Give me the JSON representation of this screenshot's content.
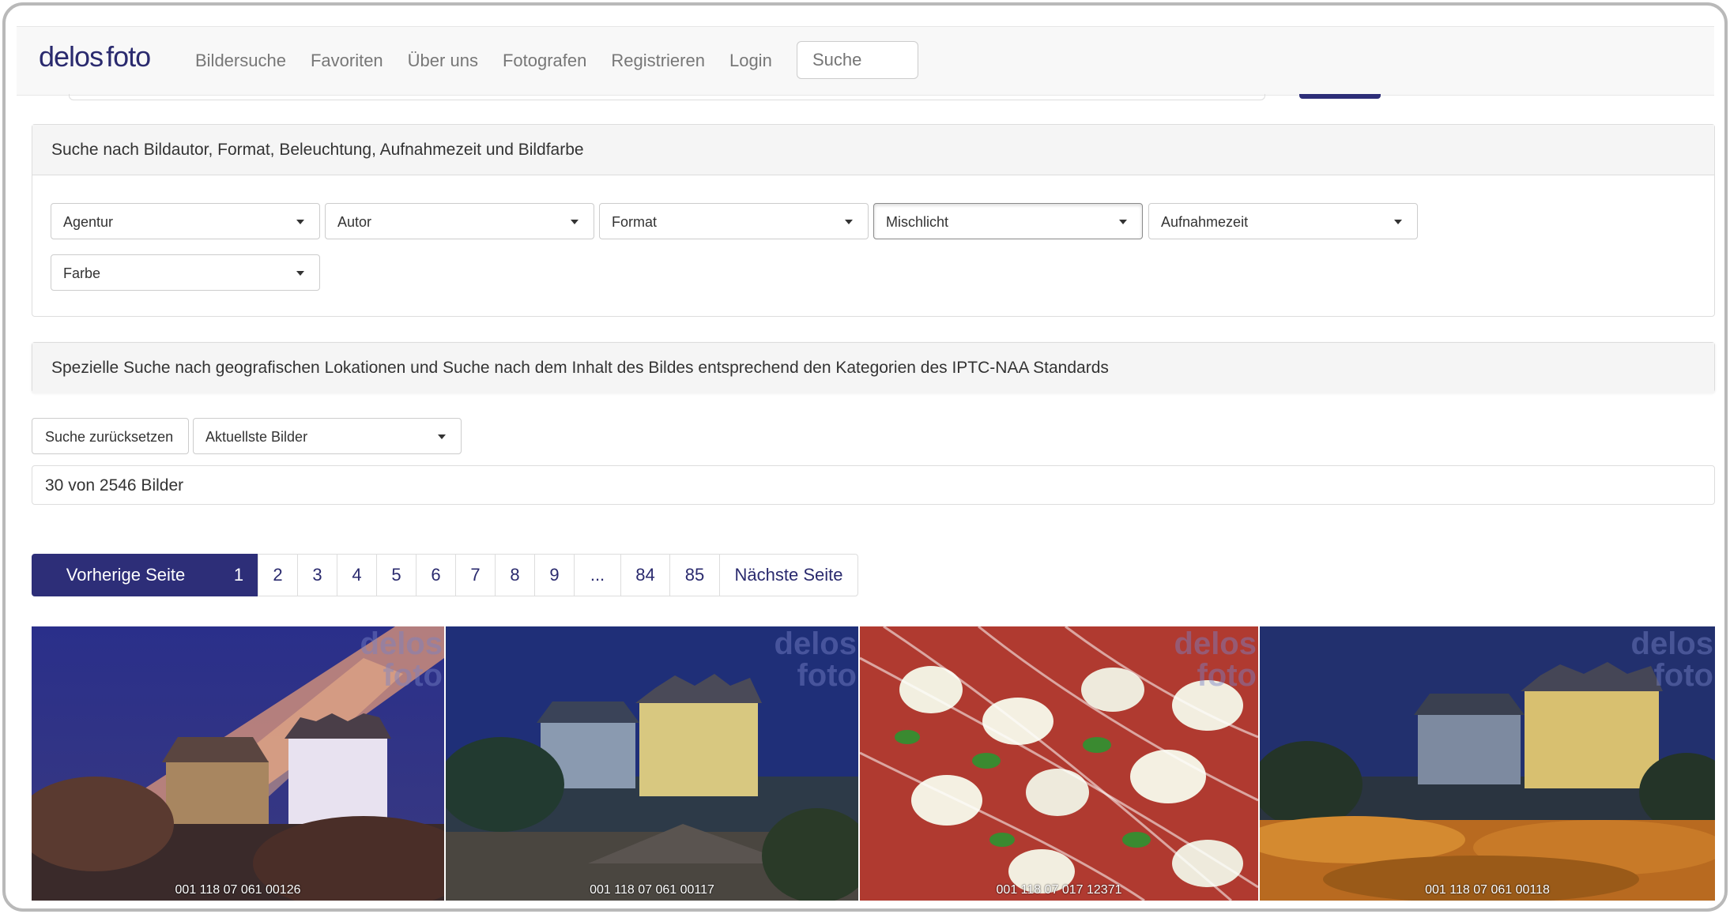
{
  "navbar": {
    "brand_part1": "delos",
    "brand_part2": "foto",
    "links": [
      "Bildersuche",
      "Favoriten",
      "Über uns",
      "Fotografen",
      "Registrieren",
      "Login"
    ],
    "search_placeholder": "Suche"
  },
  "filter_panel": {
    "heading": "Suche nach Bildautor, Format, Beleuchtung, Aufnahmezeit und Bildfarbe",
    "dropdowns": [
      "Agentur",
      "Autor",
      "Format",
      "Mischlicht",
      "Aufnahmezeit",
      "Farbe"
    ]
  },
  "geo_panel": {
    "heading": "Spezielle Suche nach geografischen Lokationen und Suche nach dem Inhalt des Bildes entsprechend den Kategorien des IPTC-NAA Standards"
  },
  "controls": {
    "reset_label": "Suche zurücksetzen",
    "sort_selected": "Aktuellste Bilder"
  },
  "results": {
    "count_text": "30 von 2546 Bilder"
  },
  "pagination": {
    "prev_label": "Vorherige Seite",
    "pages": [
      "1",
      "2",
      "3",
      "4",
      "5",
      "6",
      "7",
      "8",
      "9",
      "...",
      "84",
      "85"
    ],
    "active_page": "1",
    "next_label": "Nächste Seite"
  },
  "images": [
    {
      "id": "001 118 07 061 00126",
      "watermark1": "delos",
      "watermark2": "foto",
      "icon": "castle-night-light-beam"
    },
    {
      "id": "001 118 07 061 00117",
      "watermark1": "delos",
      "watermark2": "foto",
      "icon": "castle-night-town"
    },
    {
      "id": "001 118 07 017 12371",
      "watermark1": "delos",
      "watermark2": "foto",
      "icon": "tomato-mozzarella-salad"
    },
    {
      "id": "001 118 07 061 00118",
      "watermark1": "delos",
      "watermark2": "foto",
      "icon": "castle-night-field"
    }
  ],
  "colors": {
    "brand": "#2a2a6e",
    "primary": "#2d2e78"
  }
}
